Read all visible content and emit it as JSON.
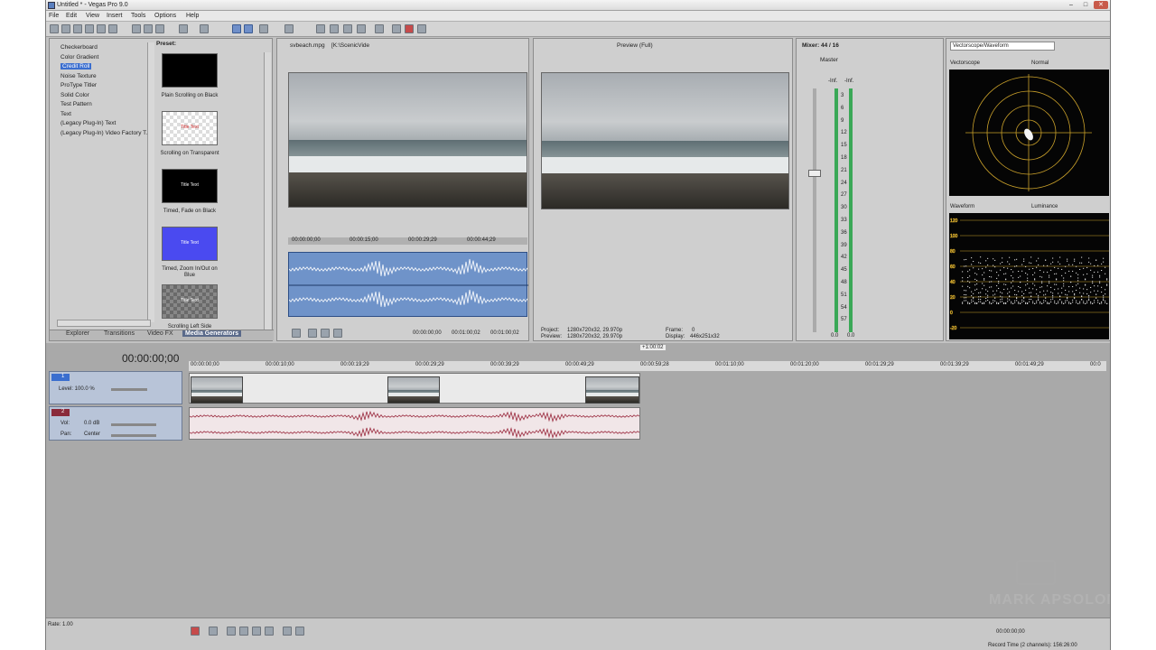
{
  "window": {
    "title": "Untitled * - Vegas Pro 9.0"
  },
  "menu": [
    "File",
    "Edit",
    "View",
    "Insert",
    "Tools",
    "Options",
    "Help"
  ],
  "media_generators": {
    "items": [
      "Checkerboard",
      "Color Gradient",
      "Credit Roll",
      "Noise Texture",
      "ProType Titler",
      "Solid Color",
      "Test Pattern",
      "Text",
      "(Legacy Plug-In) Text",
      "(Legacy Plug-In) Video Factory T..."
    ],
    "selected_index": 2,
    "preset_label": "Preset:",
    "presets": [
      {
        "caption": "Plain Scrolling on Black",
        "thumb_text": ""
      },
      {
        "caption": "Scrolling on Transparent",
        "thumb_text": "Title Text"
      },
      {
        "caption": "Timed, Fade on Black",
        "thumb_text": "Title Text"
      },
      {
        "caption": "Timed, Zoom In/Out on Blue",
        "thumb_text": "Title Text"
      },
      {
        "caption": "Scrolling Left Side",
        "thumb_text": "Title Text"
      }
    ],
    "tabs": [
      "Explorer",
      "Transitions",
      "Video FX",
      "Media Generators"
    ],
    "active_tab": "Media Generators"
  },
  "trimmer": {
    "file": "svbeach.mpg",
    "path": "[K:\\ScenicVide",
    "ruler": [
      "00:00:00;00",
      "00:00:15;00",
      "00:00:29;29",
      "00:00:44;29"
    ],
    "time_in": "00:00:00;00",
    "time_out": "00:01:00;02",
    "duration": "00:01:00;02"
  },
  "preview": {
    "mode": "Preview (Full)",
    "project_label": "Project:",
    "project_value": "1280x720x32, 29.970p",
    "preview_label": "Preview:",
    "preview_value": "1280x720x32, 29.970p",
    "frame_label": "Frame:",
    "frame_value": "0",
    "display_label": "Display:",
    "display_value": "446x251x32"
  },
  "mixer": {
    "title": "Mixer: 44 / 16",
    "channel": "Master",
    "peak_left": "-Inf.",
    "peak_right": "-Inf.",
    "scale": [
      "3",
      "6",
      "9",
      "12",
      "15",
      "18",
      "21",
      "24",
      "27",
      "30",
      "33",
      "36",
      "39",
      "42",
      "45",
      "48",
      "51",
      "54",
      "57"
    ],
    "fader_left": "0.0",
    "fader_right": "0.0"
  },
  "scopes": {
    "selector": "Vectorscope/Waveform",
    "vectorscope_label": "Vectorscope",
    "vectorscope_mode": "Normal",
    "waveform_label": "Waveform",
    "waveform_mode": "Luminance",
    "waveform_scale": [
      "120",
      "100",
      "80",
      "60",
      "40",
      "20",
      "0",
      "-20"
    ]
  },
  "timeline": {
    "cursor_time": "00:00:00;00",
    "marker": "+1:00:02",
    "ruler": [
      "00:00:00;00",
      "00:00:10;00",
      "00:00:19;29",
      "00:00:29;29",
      "00:00:39;29",
      "00:00:49;29",
      "00:00:59;28",
      "00:01:10;00",
      "00:01:20;00",
      "00:01:29;29",
      "00:01:39;29",
      "00:01:49;29",
      "00:0"
    ],
    "video_track": {
      "number": "1",
      "level_label": "Level: 100.0 %"
    },
    "audio_track": {
      "number": "2",
      "vol_label": "Vol:",
      "vol_value": "0.0 dB",
      "pan_label": "Pan:",
      "pan_value": "Center"
    },
    "rate": "Rate: 1.00",
    "transport_time": "00:00:00;00",
    "record_time": "Record Time (2 channels): 156:26:00"
  },
  "watermark": "MARK APSOLON",
  "colors": {
    "accent": "#3a6ecf",
    "audio_clip": "#b85a6e",
    "video_track": "#3a6ecf",
    "trimmer_wave_bg": "#6f93c9"
  }
}
